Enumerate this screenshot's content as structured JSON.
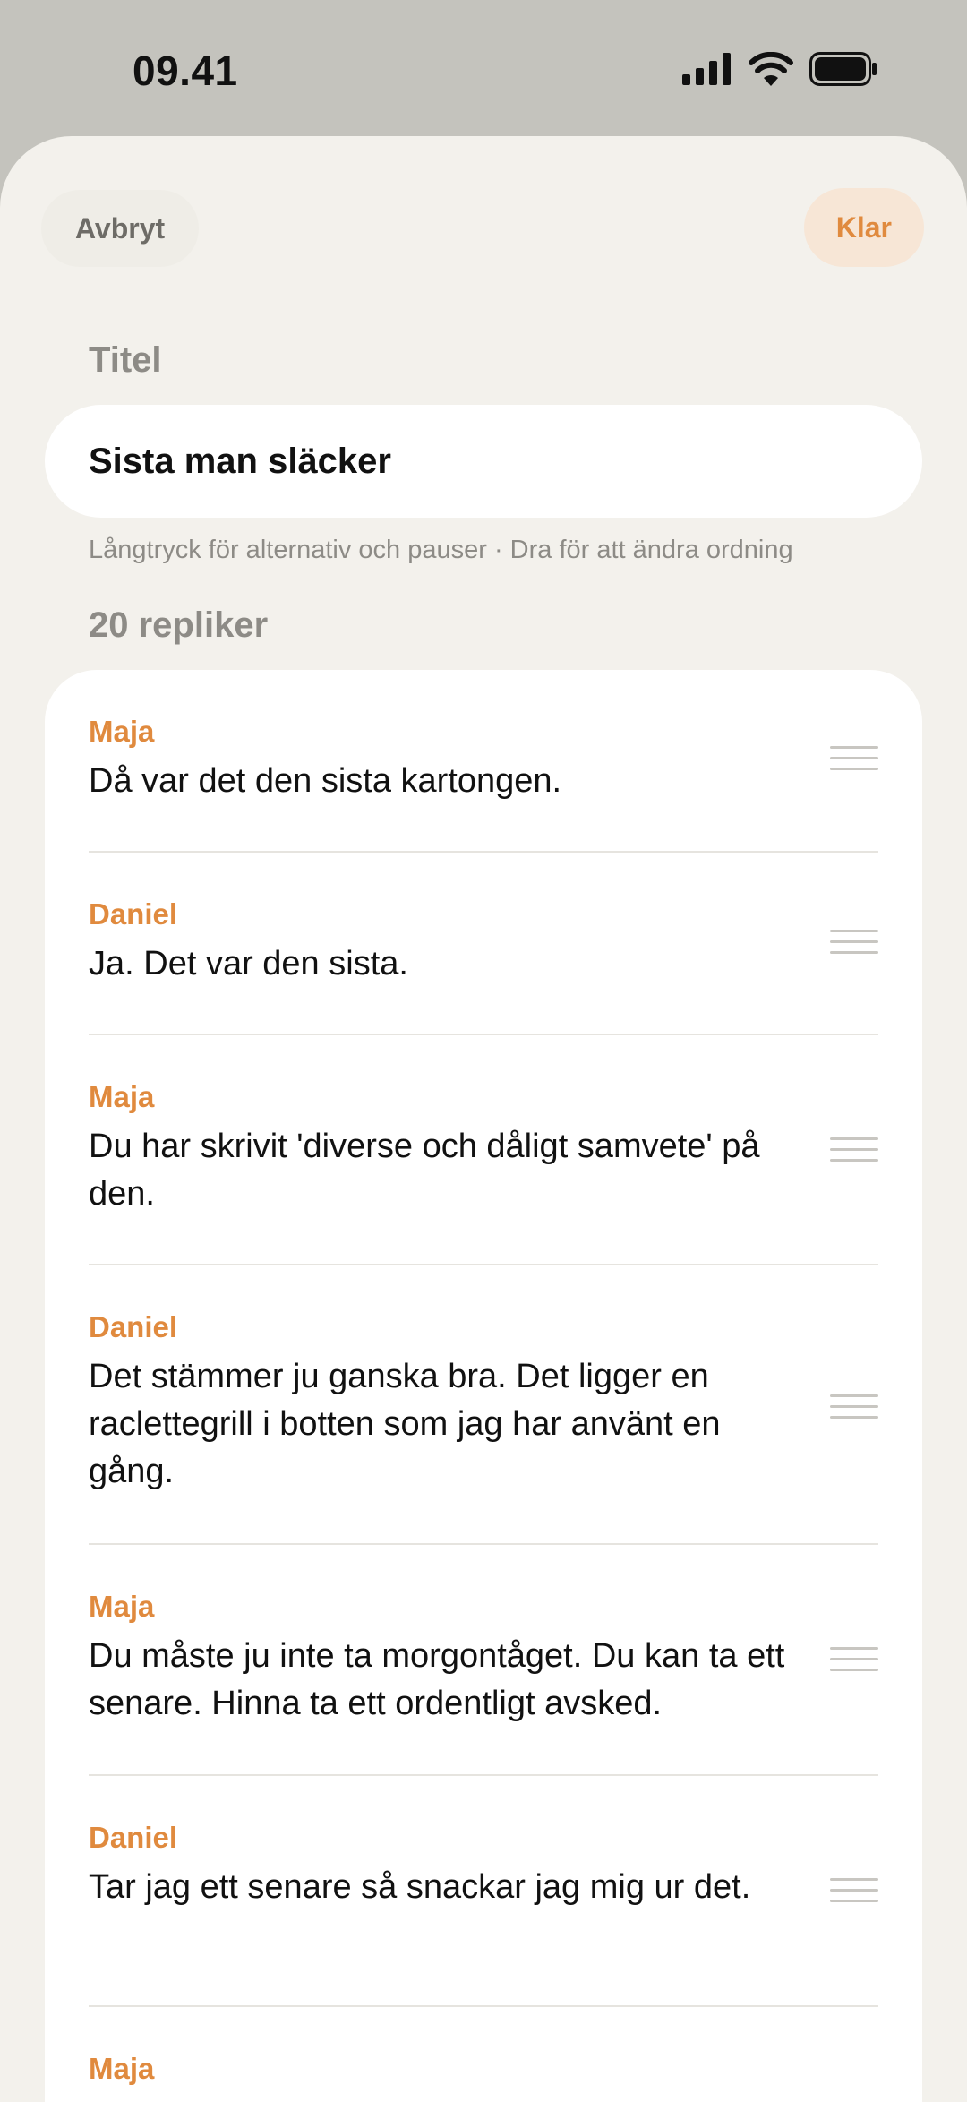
{
  "status": {
    "time": "09.41"
  },
  "header": {
    "cancel_label": "Avbryt",
    "done_label": "Klar"
  },
  "title_section": {
    "label": "Titel",
    "value": "Sista man släcker"
  },
  "hint": "Långtryck för alternativ och pauser · Dra för att ändra ordning",
  "lines_count_label": "20 repliker",
  "colors": {
    "accent": "#e08a3e",
    "sheet_bg": "#f3f1ec",
    "backdrop": "#c4c3bd"
  },
  "lines": [
    {
      "speaker": "Maja",
      "text": "Då var det den sista kartongen."
    },
    {
      "speaker": "Daniel",
      "text": "Ja. Det var den sista."
    },
    {
      "speaker": "Maja",
      "text": "Du har skrivit 'diverse och dåligt samvete' på den."
    },
    {
      "speaker": "Daniel",
      "text": "Det stämmer ju ganska bra. Det ligger en raclettegrill i botten som jag har använt en gång."
    },
    {
      "speaker": "Maja",
      "text": "Du måste ju inte ta morgontåget. Du kan ta ett senare. Hinna ta ett ordentligt avsked."
    },
    {
      "speaker": "Daniel",
      "text": "Tar jag ett senare så snackar jag mig ur det."
    },
    {
      "speaker": "Maja",
      "text": ""
    }
  ]
}
